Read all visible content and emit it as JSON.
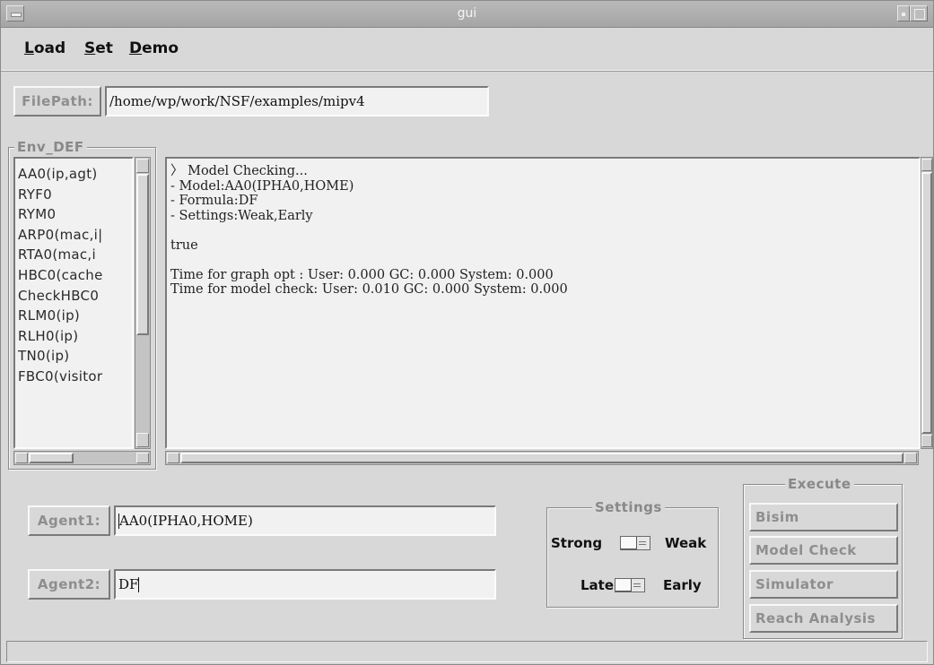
{
  "window": {
    "title": "gui"
  },
  "menubar": {
    "items": [
      {
        "underline": "L",
        "rest": "oad"
      },
      {
        "underline": "S",
        "rest": "et"
      },
      {
        "underline": "D",
        "rest": "emo"
      }
    ]
  },
  "filepath": {
    "label": "FilePath:",
    "value": "/home/wp/work/NSF/examples/mipv4"
  },
  "env_def": {
    "title": "Env_DEF",
    "items": [
      "AA0(ip,agt)",
      "RYF0",
      "RYM0",
      "ARP0(mac,i|",
      "RTA0(mac,i",
      "HBC0(cache",
      "CheckHBC0",
      "RLM0(ip)",
      "RLH0(ip)",
      "TN0(ip)",
      "FBC0(visitor"
    ]
  },
  "console": {
    "lines": [
      "〉 Model Checking...",
      "- Model:AA0(IPHA0,HOME)",
      "- Formula:DF",
      "- Settings:Weak,Early",
      "",
      "true",
      "",
      "Time for graph opt : User: 0.000 GC: 0.000 System: 0.000",
      "Time for model check: User: 0.010 GC: 0.000 System: 0.000"
    ]
  },
  "agents": {
    "agent1_label": "Agent1:",
    "agent1_value": "AA0(IPHA0,HOME)",
    "agent2_label": "Agent2:",
    "agent2_value": "DF"
  },
  "settings": {
    "title": "Settings",
    "row1_left": "Strong",
    "row1_right": "Weak",
    "row2_left": "Late",
    "row2_right": "Early"
  },
  "execute": {
    "title": "Execute",
    "buttons": [
      "Bisim",
      "Model Check",
      "Simulator",
      "Reach Analysis"
    ]
  },
  "status": {
    "text": ""
  }
}
